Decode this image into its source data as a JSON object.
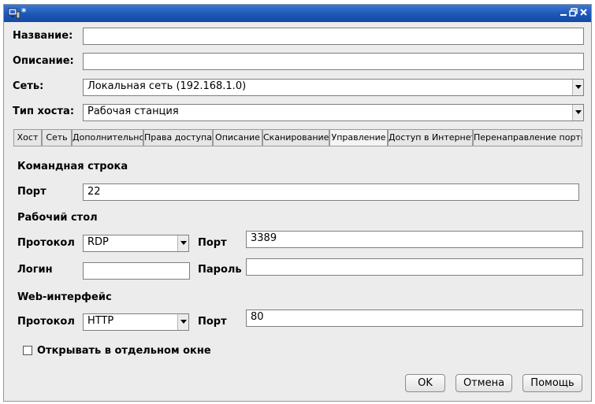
{
  "window": {
    "title": "*"
  },
  "form": {
    "name_label": "Название:",
    "name_value": "",
    "description_label": "Описание:",
    "description_value": "",
    "network_label": "Сеть:",
    "network_value": "Локальная сеть (192.168.1.0)",
    "host_type_label": "Тип хоста:",
    "host_type_value": "Рабочая станция"
  },
  "tabs": [
    {
      "label": "Хост"
    },
    {
      "label": "Сеть"
    },
    {
      "label": "Дополнительно"
    },
    {
      "label": "Права доступа"
    },
    {
      "label": "Описание"
    },
    {
      "label": "Сканирование"
    },
    {
      "label": "Управление"
    },
    {
      "label": "Доступ в Интернет"
    },
    {
      "label": "Перенаправление портов"
    }
  ],
  "management": {
    "cmd_heading": "Командная строка",
    "cmd_port_label": "Порт",
    "cmd_port_value": "22",
    "desktop_heading": "Рабочий стол",
    "desktop_protocol_label": "Протокол",
    "desktop_protocol_value": "RDP",
    "desktop_port_label": "Порт",
    "desktop_port_value": "3389",
    "login_label": "Логин",
    "login_value": "",
    "password_label": "Пароль",
    "password_value": "",
    "web_heading": "Web-интерфейс",
    "web_protocol_label": "Протокол",
    "web_protocol_value": "HTTP",
    "web_port_label": "Порт",
    "web_port_value": "80",
    "open_separate_label": "Открывать в отдельном окне",
    "open_separate_checked": false
  },
  "buttons": {
    "ok": "OK",
    "cancel": "Отмена",
    "help": "Помощь"
  },
  "icons": {
    "app": "computer-icon",
    "minimize": "minimize-icon",
    "restore": "restore-icon",
    "close": "close-icon",
    "dropdown": "chevron-down-icon"
  },
  "colors": {
    "titlebar": "#1c57b8",
    "window_bg": "#ececec"
  }
}
